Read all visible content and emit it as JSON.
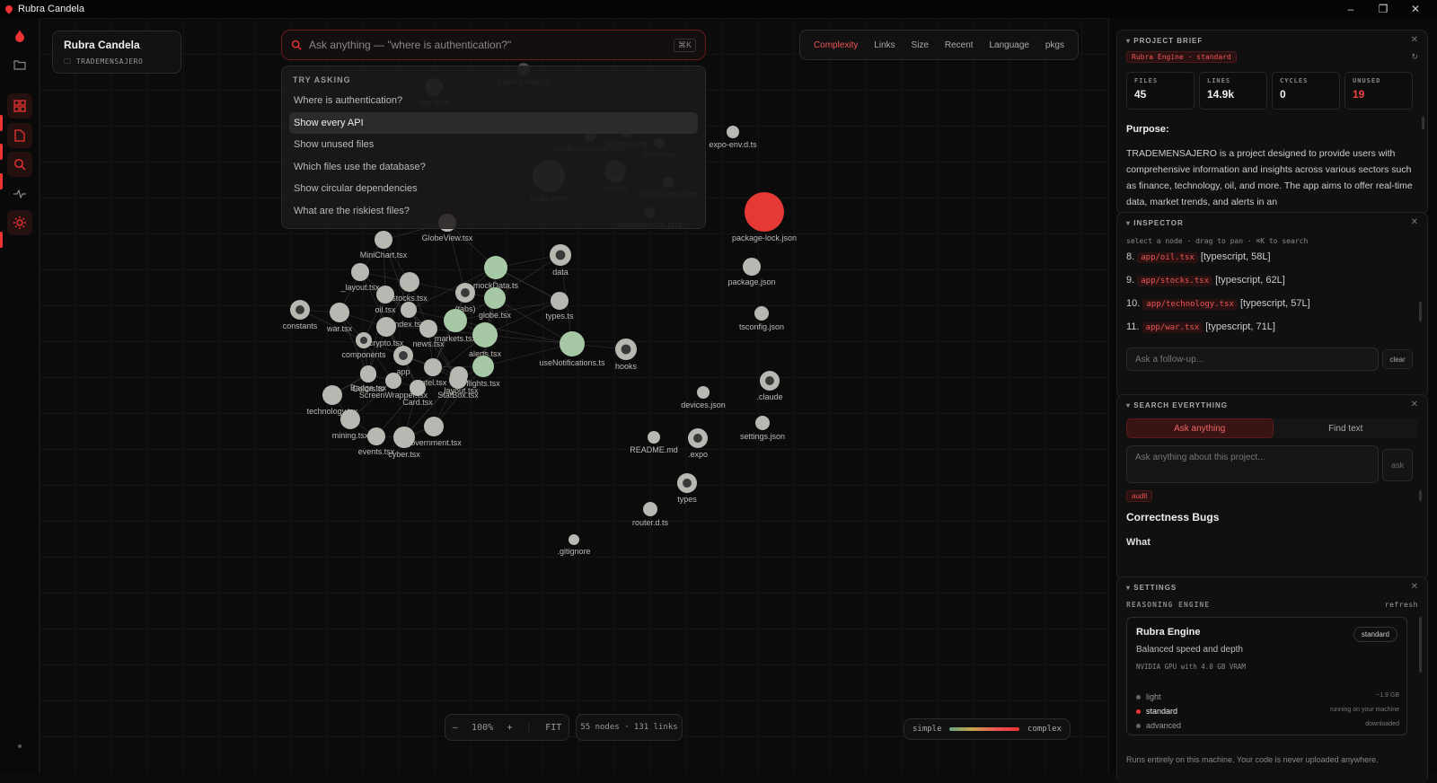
{
  "window": {
    "title": "Rubra Candela",
    "minimize": "–",
    "restore": "❐",
    "close": "✕"
  },
  "rail": {
    "items": [
      "logo-flame",
      "folder",
      "grid",
      "file",
      "search",
      "pulse",
      "settings"
    ]
  },
  "project": {
    "name": "Rubra Candela",
    "folder": "TRADEMENSAJERO"
  },
  "search": {
    "placeholder": "Ask anything — \"where is authentication?\"",
    "shortcut": "⌘K"
  },
  "suggestions": {
    "header": "TRY ASKING",
    "items": [
      "Where is authentication?",
      "Show every API",
      "Show unused files",
      "Which files use the database?",
      "Show circular dependencies",
      "What are the riskiest files?"
    ],
    "selected_index": 1
  },
  "sorts": {
    "items": [
      "Complexity",
      "Links",
      "Size",
      "Recent",
      "Language",
      "pkgs"
    ],
    "active": "Complexity"
  },
  "zoom": {
    "minus": "–",
    "level": "100%",
    "plus": "+",
    "fit": "FIT"
  },
  "graph_stats": "55 nodes · 131 links",
  "legend": {
    "left": "simple",
    "right": "complex"
  },
  "graph": {
    "nodes": [
      {
        "label": "babel.config.js",
        "type": "file",
        "tone": "gray"
      },
      {
        "label": "app.json",
        "type": "file",
        "tone": "gray"
      },
      {
        "label": "notification-icon.png",
        "type": "file",
        "tone": "gray"
      },
      {
        "label": "favicon.png",
        "type": "file",
        "tone": "gray"
      },
      {
        "label": "icon.png",
        "type": "file",
        "tone": "gray"
      },
      {
        "label": "globe.html",
        "type": "file",
        "tone": "gray"
      },
      {
        "label": "assets",
        "type": "folder",
        "tone": "gray"
      },
      {
        "label": "splash-icon.png",
        "type": "file",
        "tone": "gray"
      },
      {
        "label": "adaptive-icon.png",
        "type": "file",
        "tone": "gray"
      },
      {
        "label": "expo-env.d.ts",
        "type": "file",
        "tone": "light"
      },
      {
        "label": "package-lock.json",
        "type": "file",
        "tone": "red"
      },
      {
        "label": "package.json",
        "type": "file",
        "tone": "light"
      },
      {
        "label": "tsconfig.json",
        "type": "file",
        "tone": "light"
      },
      {
        "label": "GlobeView.tsx",
        "type": "file",
        "tone": "light"
      },
      {
        "label": "MiniChart.tsx",
        "type": "file",
        "tone": "light"
      },
      {
        "label": "data",
        "type": "folder",
        "tone": "light"
      },
      {
        "label": "_layout.tsx",
        "type": "file",
        "tone": "light"
      },
      {
        "label": "mockData.ts",
        "type": "file",
        "tone": "green"
      },
      {
        "label": "stocks.tsx",
        "type": "file",
        "tone": "light"
      },
      {
        "label": "(tabs)",
        "type": "folder",
        "tone": "light"
      },
      {
        "label": "oil.tsx",
        "type": "file",
        "tone": "light"
      },
      {
        "label": "index.tsx",
        "type": "file",
        "tone": "light"
      },
      {
        "label": "globe.tsx",
        "type": "file",
        "tone": "green"
      },
      {
        "label": "types.ts",
        "type": "file",
        "tone": "light"
      },
      {
        "label": "constants",
        "type": "folder",
        "tone": "light"
      },
      {
        "label": "war.tsx",
        "type": "file",
        "tone": "light"
      },
      {
        "label": "crypto.tsx",
        "type": "file",
        "tone": "light"
      },
      {
        "label": "markets.tsx",
        "type": "file",
        "tone": "green"
      },
      {
        "label": "components",
        "type": "folder",
        "tone": "light"
      },
      {
        "label": "news.tsx",
        "type": "file",
        "tone": "light"
      },
      {
        "label": "alerts.tsx",
        "type": "file",
        "tone": "green"
      },
      {
        "label": "useNotifications.ts",
        "type": "file",
        "tone": "green"
      },
      {
        "label": "hooks",
        "type": "folder",
        "tone": "light"
      },
      {
        "label": "Colors.ts",
        "type": "file",
        "tone": "light"
      },
      {
        "label": "app",
        "type": "folder",
        "tone": "light"
      },
      {
        "label": "intel.tsx",
        "type": "file",
        "tone": "light"
      },
      {
        "label": "StatBox.tsx",
        "type": "file",
        "tone": "light"
      },
      {
        "label": "flights.tsx",
        "type": "file",
        "tone": "green"
      },
      {
        "label": "Badge.tsx",
        "type": "file",
        "tone": "light"
      },
      {
        "label": "ScreenWrapper.tsx",
        "type": "file",
        "tone": "light"
      },
      {
        "label": "_layout.tsx",
        "type": "file",
        "tone": "light"
      },
      {
        "label": "Card.tsx",
        "type": "file",
        "tone": "light"
      },
      {
        "label": "technology.tsx",
        "type": "file",
        "tone": "light"
      },
      {
        "label": "mining.tsx",
        "type": "file",
        "tone": "light"
      },
      {
        "label": "government.tsx",
        "type": "file",
        "tone": "light"
      },
      {
        "label": "events.tsx",
        "type": "file",
        "tone": "light"
      },
      {
        "label": "cyber.tsx",
        "type": "file",
        "tone": "light"
      },
      {
        "label": ".claude",
        "type": "folder",
        "tone": "light"
      },
      {
        "label": "devices.json",
        "type": "file",
        "tone": "light"
      },
      {
        "label": "settings.json",
        "type": "file",
        "tone": "light"
      },
      {
        "label": "README.md",
        "type": "file",
        "tone": "light"
      },
      {
        "label": ".expo",
        "type": "folder",
        "tone": "light"
      },
      {
        "label": "types",
        "type": "folder",
        "tone": "light"
      },
      {
        "label": "router.d.ts",
        "type": "file",
        "tone": "light"
      },
      {
        "label": ".gitignore",
        "type": "file",
        "tone": "light"
      }
    ],
    "colors": {
      "gray": "#4a4848",
      "light": "#b9b7b1",
      "green": "#a6c8a4",
      "red": "#e53935"
    }
  },
  "brief": {
    "title": "PROJECT BRIEF",
    "engine_chip": "Rubra Engine · standard",
    "stats": [
      {
        "label": "FILES",
        "value": "45"
      },
      {
        "label": "LINES",
        "value": "14.9k"
      },
      {
        "label": "CYCLES",
        "value": "0"
      },
      {
        "label": "UNUSED",
        "value": "19"
      }
    ],
    "purpose_label": "Purpose:",
    "purpose_text": "TRADEMENSAJERO is a project designed to provide users with comprehensive information and insights across various sectors such as finance, technology, oil, and more. The app aims to offer real-time data, market trends, and alerts in an"
  },
  "inspector": {
    "title": "INSPECTOR",
    "hint": "select a node · drag to pan · ⌘K to search",
    "rows": [
      {
        "n": "8.",
        "path": "app/oil.tsx",
        "meta": "[typescript, 58L]"
      },
      {
        "n": "9.",
        "path": "app/stocks.tsx",
        "meta": "[typescript, 62L]"
      },
      {
        "n": "10.",
        "path": "app/technology.tsx",
        "meta": "[typescript, 57L]"
      },
      {
        "n": "11.",
        "path": "app/war.tsx",
        "meta": "[typescript, 71L]"
      }
    ],
    "followup_placeholder": "Ask a follow-up...",
    "clear": "clear"
  },
  "searchall": {
    "title": "SEARCH EVERYTHING",
    "tab_ask": "Ask anything",
    "tab_find": "Find text",
    "placeholder": "Ask anything about this project...",
    "ask": "ask",
    "tag": "audit",
    "heading": "Correctness Bugs",
    "sub": "What"
  },
  "settings": {
    "title": "SETTINGS",
    "section": "REASONING ENGINE",
    "refresh": "refresh",
    "engine_name": "Rubra Engine",
    "engine_badge": "standard",
    "engine_desc": "Balanced speed and depth",
    "gpu": "NVIDIA GPU with 4.0 GB VRAM",
    "options": [
      {
        "name": "light",
        "note": "~1.9 GB"
      },
      {
        "name": "standard",
        "note": "running on your machine"
      },
      {
        "name": "advanced",
        "note": "downloaded"
      }
    ],
    "footer": "Runs entirely on this machine. Your code is never uploaded anywhere."
  },
  "accent": "#e53935"
}
